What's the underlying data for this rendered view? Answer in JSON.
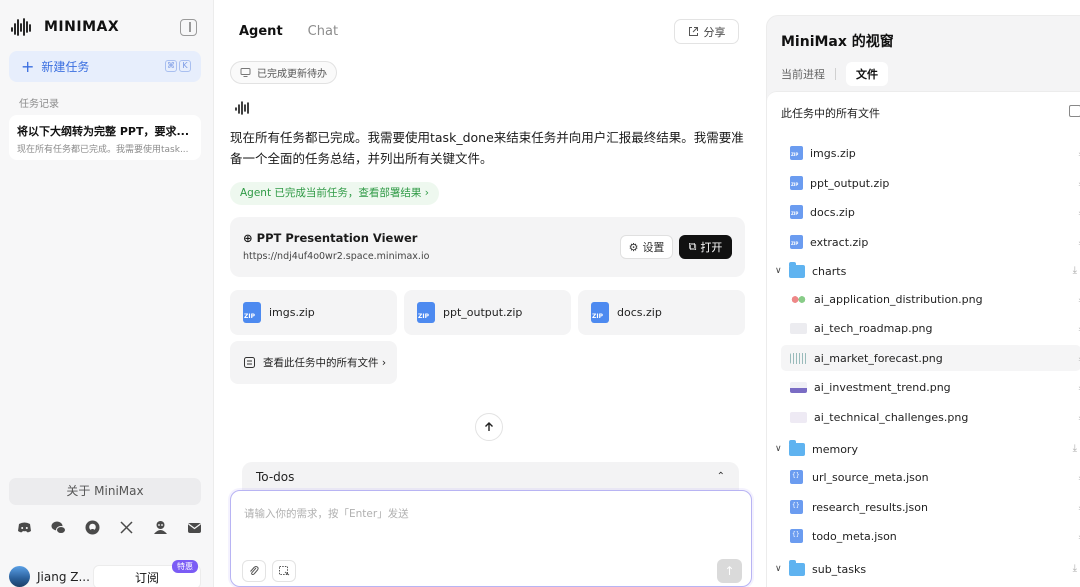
{
  "sidebar": {
    "logo_text": "MINIMAX",
    "new_task_label": "新建任务",
    "new_task_shortcut": [
      "⌘",
      "K"
    ],
    "history_title": "任务记录",
    "history": [
      {
        "title": "将以下大纲转为完整 PPT，要求...",
        "subtitle": "现在所有任务都已完成。我需要使用task..."
      }
    ],
    "about_label": "关于 MiniMax",
    "socials": [
      "discord-icon",
      "wechat-icon",
      "github-icon",
      "x-icon",
      "community-icon",
      "mail-icon"
    ],
    "user_name": "Jiang Z...",
    "subscribe_label": "订阅",
    "badge": "特惠"
  },
  "center": {
    "tabs": [
      {
        "label": "Agent",
        "active": true
      },
      {
        "label": "Chat",
        "active": false
      }
    ],
    "share_label": "分享",
    "status_chip": "已完成更新待办",
    "message": "现在所有任务都已完成。我需要使用task_done来结束任务并向用户汇报最终结果。我需要准备一个全面的任务总结，并列出所有关键文件。",
    "done_link": "Agent 已完成当前任务，查看部署结果 ›",
    "viewer": {
      "title": "PPT Presentation Viewer",
      "url": "https://ndj4uf4o0wr2.space.minimax.io",
      "settings_label": "设置",
      "open_label": "打开"
    },
    "files": [
      "imgs.zip",
      "ppt_output.zip",
      "docs.zip"
    ],
    "all_files_label": "查看此任务中的所有文件 ›",
    "todos_label": "To-dos",
    "composer_placeholder": "请输入你的需求，按「Enter」发送"
  },
  "right": {
    "title": "MiniMax 的视窗",
    "tabs": [
      {
        "label": "当前进程",
        "active": false
      },
      {
        "label": "文件",
        "active": true
      }
    ],
    "files_header": "此任务中的所有文件",
    "rows": [
      {
        "type": "zip",
        "name": "imgs.zip"
      },
      {
        "type": "zip",
        "name": "ppt_output.zip"
      },
      {
        "type": "zip",
        "name": "docs.zip"
      },
      {
        "type": "zip",
        "name": "extract.zip"
      },
      {
        "type": "folder",
        "name": "charts"
      },
      {
        "type": "image",
        "name": "ai_application_distribution.png"
      },
      {
        "type": "image",
        "name": "ai_tech_roadmap.png"
      },
      {
        "type": "image",
        "name": "ai_market_forecast.png",
        "highlight": true
      },
      {
        "type": "image",
        "name": "ai_investment_trend.png"
      },
      {
        "type": "image",
        "name": "ai_technical_challenges.png"
      },
      {
        "type": "folder",
        "name": "memory"
      },
      {
        "type": "json",
        "name": "url_source_meta.json"
      },
      {
        "type": "json",
        "name": "research_results.json"
      },
      {
        "type": "json",
        "name": "todo_meta.json"
      },
      {
        "type": "folder",
        "name": "sub_tasks"
      }
    ]
  }
}
